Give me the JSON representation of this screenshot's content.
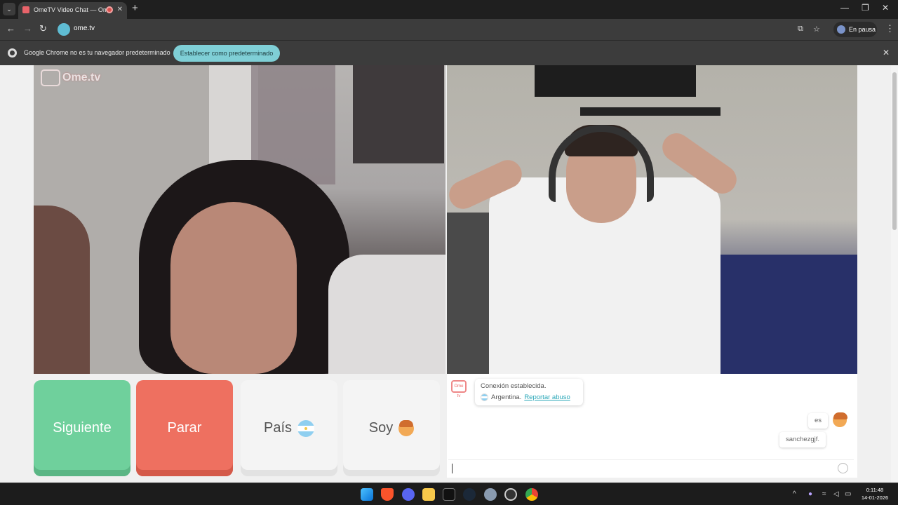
{
  "browser": {
    "tab_title": "OmeTV Video Chat — Ome",
    "tab_close": "✕",
    "new_tab": "+",
    "url": "ome.tv",
    "profile_label": "En pausa",
    "window_controls": [
      "—",
      "❐",
      "✕"
    ]
  },
  "infobar": {
    "message": "Google Chrome no es tu navegador predeterminado",
    "button_label": "Establecer como predeterminado",
    "close": "✕"
  },
  "page": {
    "logo_text": "Ome.tv",
    "buttons": {
      "next": "Siguiente",
      "stop": "Parar",
      "country": "País",
      "gender": "Soy"
    },
    "chat": {
      "system_line1": "Conexión establecida.",
      "system_country": "Argentina.",
      "report_link": "Reportar abuso",
      "messages": [
        "es",
        "sanchezgjf."
      ],
      "input_value": "",
      "logo_label": "Ome tv"
    }
  },
  "taskbar": {
    "time": "0:11:48",
    "date": "14-01-2026"
  },
  "colors": {
    "next_button": "#6fd09c",
    "stop_button": "#ee7060",
    "accent": "#2aa7b8",
    "infobar_button": "#7fcfd6"
  },
  "icons": [
    "tab-search-icon",
    "back-icon",
    "forward-icon",
    "reload-icon",
    "cast-icon",
    "star-icon",
    "kebab-menu-icon",
    "chrome-icon",
    "argentina-flag-icon",
    "boy-emoji-icon",
    "smiley-icon",
    "windows-start-icon",
    "wifi-icon",
    "volume-icon",
    "battery-icon"
  ]
}
